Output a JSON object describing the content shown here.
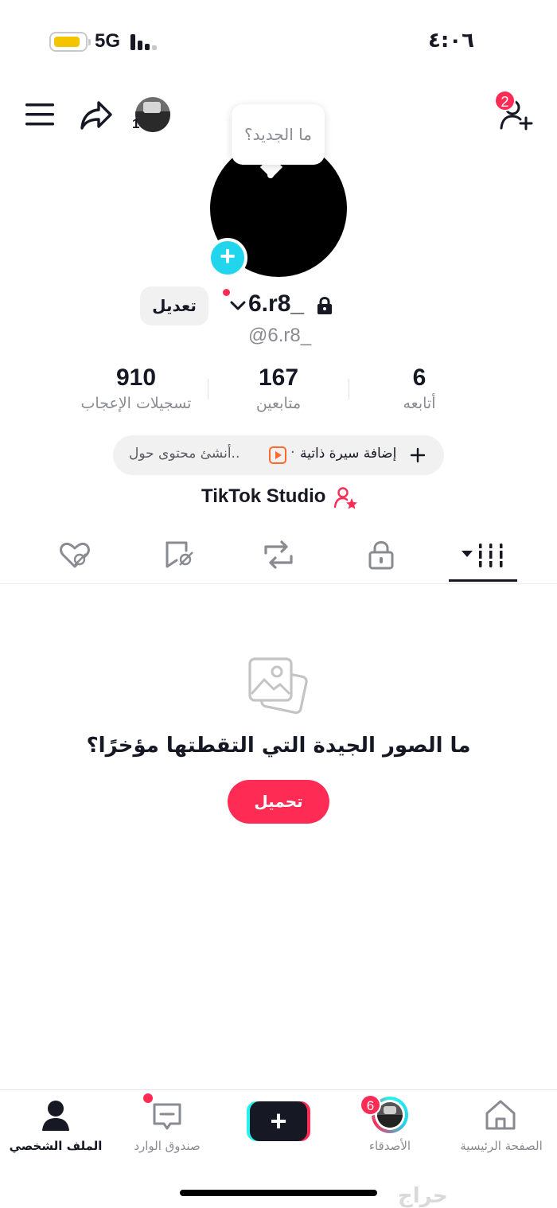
{
  "status_bar": {
    "network": "5G",
    "time": "٤:٠٦",
    "battery_level": 0.7,
    "battery_color": "#f5c400"
  },
  "header": {
    "menu_icon": "hamburger-menu-icon",
    "share_icon": "share-arrow-icon",
    "story_count": "1",
    "add_friends_badge": "2",
    "add_friends_icon": "person-plus-icon"
  },
  "profile": {
    "bubble_text": "ما الجديد؟",
    "username": "6.r8_",
    "handle": "@6.r8_",
    "edit_label": "تعديل",
    "add_icon": "plus-icon",
    "lock_icon": "lock-icon"
  },
  "stats": [
    {
      "value": "910",
      "label": "تسجيلات الإعجاب"
    },
    {
      "value": "167",
      "label": "متابعين"
    },
    {
      "value": "6",
      "label": "أتابعه"
    }
  ],
  "bio_actions": {
    "add_bio": "إضافة سيرة ذاتية",
    "create_content": "أنشئ محتوى حول..",
    "separator": "·"
  },
  "studio": {
    "label": "TikTok Studio"
  },
  "tabs": [
    {
      "icon": "liked-heart-icon",
      "active": false
    },
    {
      "icon": "favorites-bookmark-icon",
      "active": false
    },
    {
      "icon": "repost-icon",
      "active": false
    },
    {
      "icon": "private-lock-icon",
      "active": false
    },
    {
      "icon": "videos-grid-icon",
      "active": true
    }
  ],
  "empty_state": {
    "icon": "photos-icon",
    "title": "ما الصور الجيدة التي التقطتها مؤخرًا؟",
    "button": "تحميل"
  },
  "bottom_nav": {
    "items": [
      {
        "label": "الملف الشخصي",
        "icon": "profile-person-icon",
        "active": true
      },
      {
        "label": "صندوق الوارد",
        "icon": "inbox-icon",
        "active": false
      },
      {
        "label": "",
        "icon": "create-plus-icon",
        "active": false
      },
      {
        "label": "الأصدقاء",
        "icon": "friends-avatar-icon",
        "active": false,
        "badge": "6"
      },
      {
        "label": "الصفحة الرئيسية",
        "icon": "home-icon",
        "active": false
      }
    ]
  },
  "watermark": "حراج",
  "colors": {
    "accent_red": "#fe2c55",
    "accent_cyan": "#20d5ec",
    "text_primary": "#161823",
    "text_secondary": "#8a8b91"
  }
}
